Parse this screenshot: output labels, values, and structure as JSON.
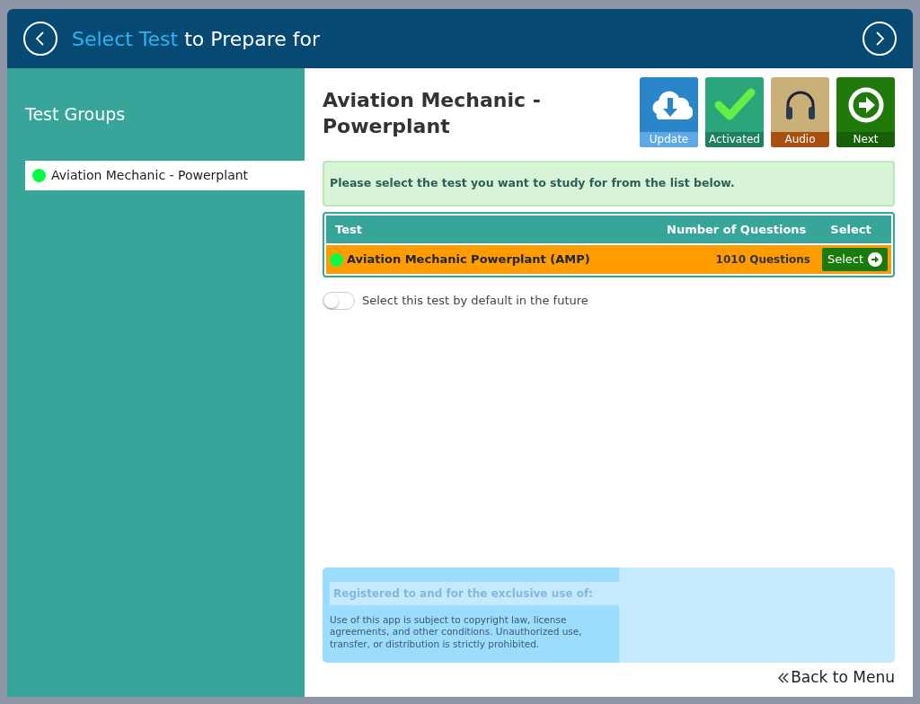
{
  "header": {
    "title_highlight": "Select Test",
    "title_rest": "to Prepare for"
  },
  "sidebar": {
    "title": "Test Groups",
    "items": [
      {
        "label": "Aviation Mechanic - Powerplant",
        "selected": true,
        "color": "#00ff40"
      }
    ]
  },
  "main": {
    "title": "Aviation Mechanic - Powerplant",
    "tiles": [
      {
        "kind": "update",
        "label": "Update"
      },
      {
        "kind": "activated",
        "label": "Activated"
      },
      {
        "kind": "audio",
        "label": "Audio"
      },
      {
        "kind": "next",
        "label": "Next"
      }
    ],
    "notice": "Please select the test you want to study for from the list below.",
    "table": {
      "columns": [
        "Test",
        "Number of Questions",
        "Select"
      ],
      "rows": [
        {
          "test": "Aviation Mechanic Powerplant (AMP)",
          "questions": "1010 Questions",
          "button": "Select",
          "selected": true,
          "color": "#00ff40"
        }
      ]
    },
    "default_toggle": {
      "label": "Select this test by default in the future",
      "on": false
    },
    "registration": {
      "heading": "Registered to and for the exclusive use of:",
      "text": "Use of this app is subject to copyright law, license agreements, and other conditions. Unauthorized use, transfer, or distribution is strictly prohibited."
    },
    "back_link": "Back to Menu"
  }
}
